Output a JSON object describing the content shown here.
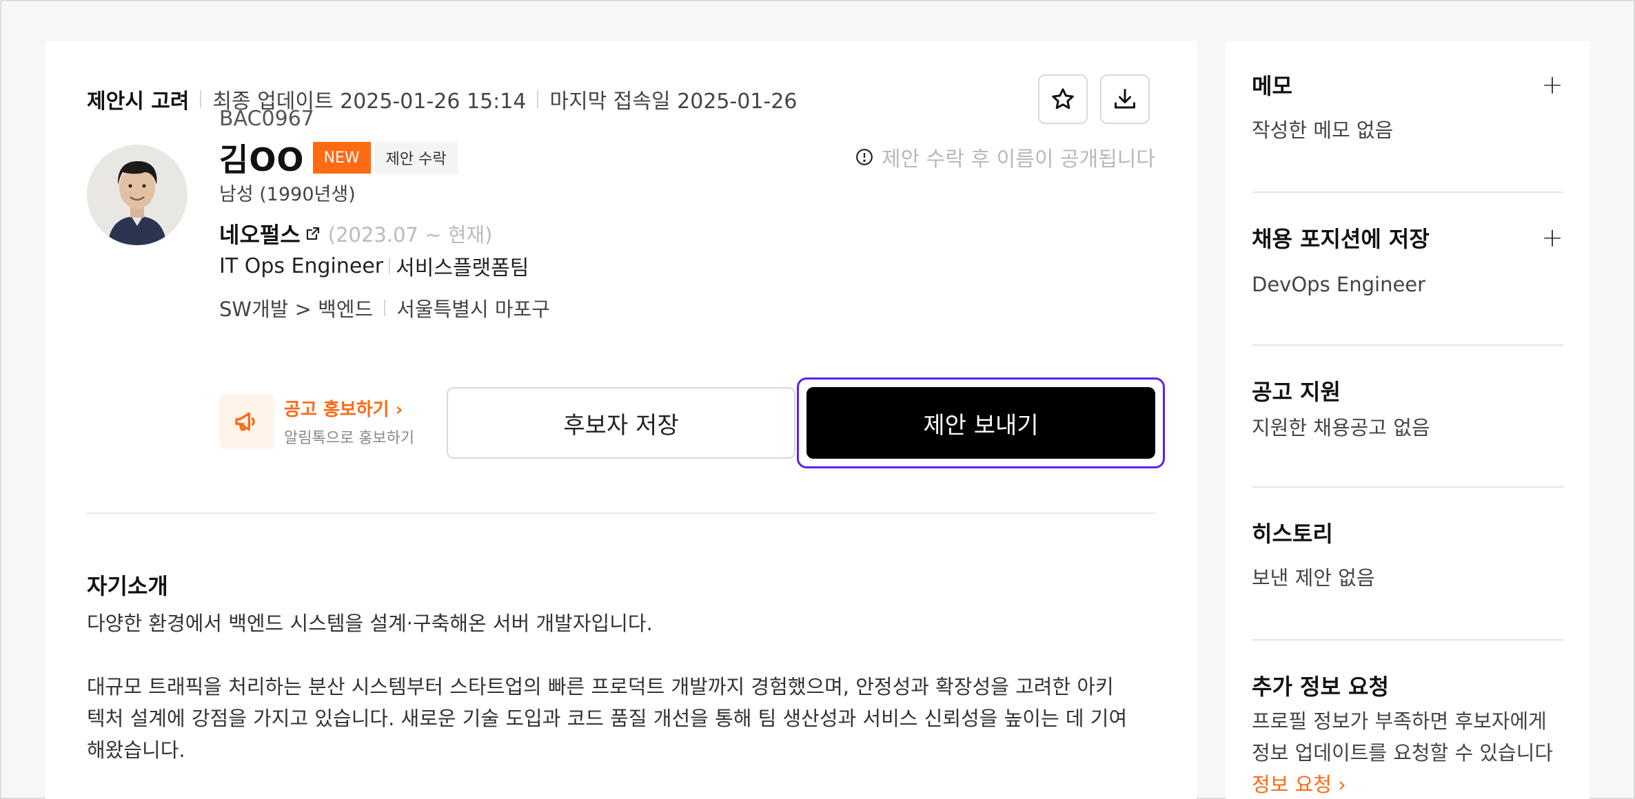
{
  "header": {
    "status": "제안시 고려",
    "updated": "최종 업데이트 2025-01-26 15:14",
    "last_access": "마지막 접속일 2025-01-26"
  },
  "candidate": {
    "id": "BAC0967",
    "name": "김OO",
    "badge_new": "NEW",
    "badge_status": "제안 수락",
    "gender": "남성 (1990년생)",
    "notice": "제안 수락 후 이름이 공개됩니다",
    "company": "네오펄스",
    "period": "(2023.07 ~ 현재)",
    "role": "IT Ops Engineer",
    "team": "서비스플랫폼팀",
    "category": "SW개발 > 백엔드",
    "location": "서울특별시 마포구"
  },
  "promo": {
    "title": "공고 홍보하기 ›",
    "subtitle": "알림톡으로 홍보하기"
  },
  "actions": {
    "save_label": "후보자 저장",
    "offer_label": "제안 보내기"
  },
  "intro": {
    "title": "자기소개",
    "paragraph1": "다양한 환경에서 백엔드 시스템을 설계·구축해온 서버 개발자입니다.",
    "paragraph2_line1": "대규모 트래픽을 처리하는 분산 시스템부터 스타트업의 빠른 프로덕트 개발까지 경험했으며, 안정성과 확장성을 고려한 아키",
    "paragraph2_line2": "텍처 설계에 강점을 가지고 있습니다. 새로운 기술 도입과 코드 품질 개선을 통해 팀 생산성과 서비스 신뢰성을 높이는 데 기여",
    "paragraph2_line3": "해왔습니다."
  },
  "sidebar": {
    "memo_title": "메모",
    "memo_text": "작성한 메모 없음",
    "position_title": "채용 포지션에 저장",
    "position_text": "DevOps Engineer",
    "apply_title": "공고 지원",
    "apply_text": "지원한 채용공고 없음",
    "history_title": "히스토리",
    "history_text": "보낸 제안 없음",
    "request_title": "추가 정보 요청",
    "request_text_line1": "프로필 정보가 부족하면 후보자에게",
    "request_text_line2": "정보 업데이트를 요청할 수 있습니다",
    "request_link": "정보 요청 ›",
    "plus_symbol": "+"
  },
  "colors": {
    "accent_orange": "#ff6a13",
    "focus_purple": "#5b21f0",
    "primary_black": "#000000"
  },
  "icons": [
    "star-icon",
    "download-icon",
    "info-icon",
    "external-link-icon",
    "megaphone-icon",
    "plus-icon"
  ]
}
